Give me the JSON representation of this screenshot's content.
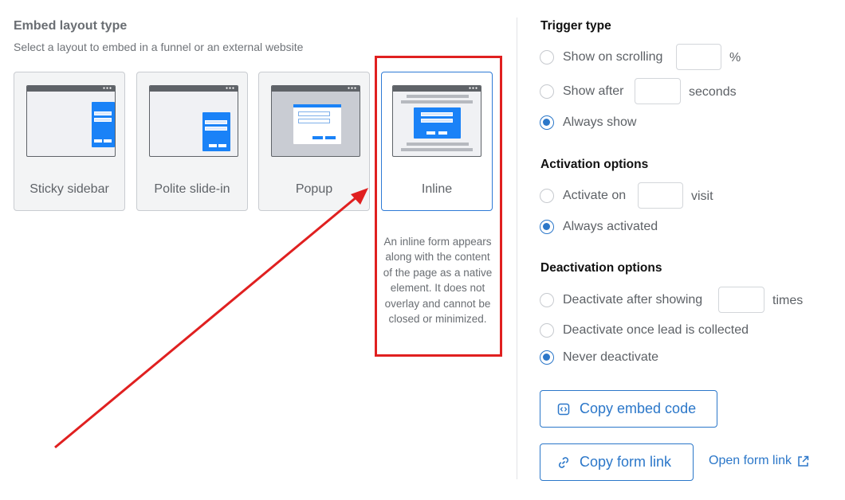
{
  "embed": {
    "title": "Embed layout type",
    "subtitle": "Select a layout to embed in a funnel or an external website",
    "layouts": [
      {
        "label": "Sticky sidebar"
      },
      {
        "label": "Polite slide-in"
      },
      {
        "label": "Popup"
      },
      {
        "label": "Inline",
        "selected": true
      }
    ],
    "description": "An inline form appears along with the content of the page as a native element. It does not overlay and cannot be closed or minimized."
  },
  "trigger": {
    "title": "Trigger type",
    "scroll_label": "Show on scrolling",
    "scroll_unit": "%",
    "after_label": "Show after",
    "after_unit": "seconds",
    "always_label": "Always show",
    "selected": "Always show"
  },
  "activation": {
    "title": "Activation options",
    "on_label": "Activate on",
    "on_unit": "visit",
    "always_label": "Always activated",
    "selected": "Always activated"
  },
  "deactivation": {
    "title": "Deactivation options",
    "after_label": "Deactivate after showing",
    "after_unit": "times",
    "lead_label": "Deactivate once lead is collected",
    "never_label": "Never deactivate",
    "selected": "Never deactivate"
  },
  "actions": {
    "copy_embed": "Copy embed code",
    "copy_link": "Copy form link",
    "open_link": "Open form link"
  },
  "icons": {
    "code": "code-icon",
    "link": "link-icon",
    "external": "external-link-icon"
  },
  "colors": {
    "accent": "#2b77c9",
    "highlight": "#e02020",
    "form_blue": "#1a82f7"
  }
}
